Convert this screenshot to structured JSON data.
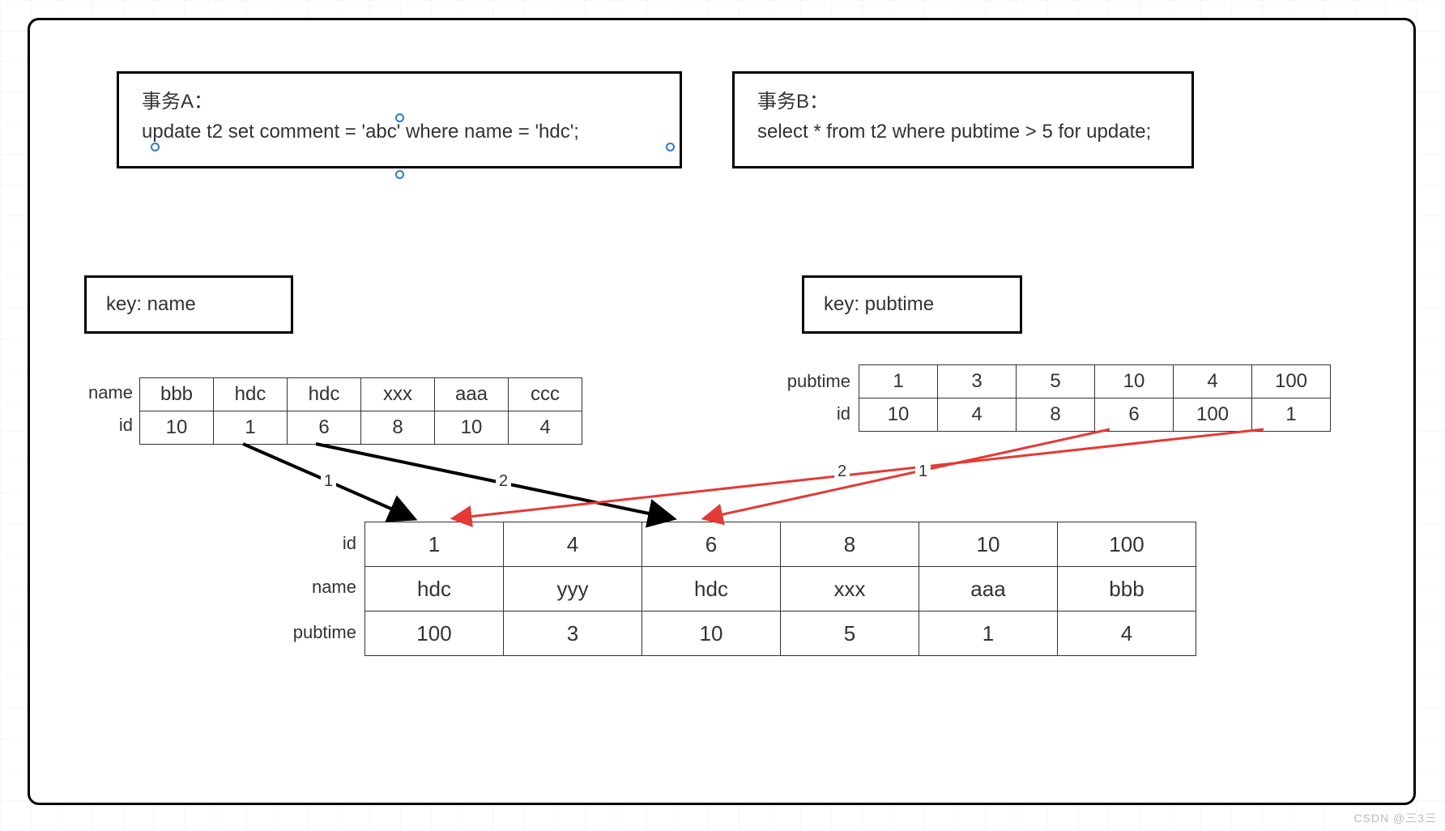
{
  "transactions": {
    "a": {
      "title": "事务A：",
      "sql": "update t2 set comment = 'abc' where name = 'hdc';"
    },
    "b": {
      "title": "事务B：",
      "sql": "select * from t2 where pubtime > 5 for update;"
    }
  },
  "keys": {
    "name": "key: name",
    "pubtime": "key: pubtime"
  },
  "index_name": {
    "labels": {
      "name": "name",
      "id": "id"
    },
    "name": [
      "bbb",
      "hdc",
      "hdc",
      "xxx",
      "aaa",
      "ccc"
    ],
    "id": [
      "10",
      "1",
      "6",
      "8",
      "10",
      "4"
    ]
  },
  "index_pubtime": {
    "labels": {
      "pubtime": "pubtime",
      "id": "id"
    },
    "pubtime": [
      "1",
      "3",
      "5",
      "10",
      "4",
      "100"
    ],
    "id": [
      "10",
      "4",
      "8",
      "6",
      "100",
      "1"
    ]
  },
  "main_table": {
    "labels": {
      "id": "id",
      "name": "name",
      "pubtime": "pubtime"
    },
    "id": [
      "1",
      "4",
      "6",
      "8",
      "10",
      "100"
    ],
    "name": [
      "hdc",
      "yyy",
      "hdc",
      "xxx",
      "aaa",
      "bbb"
    ],
    "pubtime": [
      "100",
      "3",
      "10",
      "5",
      "1",
      "4"
    ]
  },
  "arrows": {
    "black1_label": "1",
    "black2_label": "2",
    "red1_label": "1",
    "red2_label": "2"
  },
  "watermark": "CSDN @三3三"
}
